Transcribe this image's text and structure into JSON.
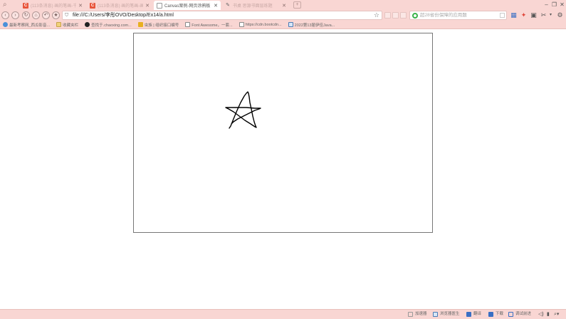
{
  "browser": {
    "tabs": [
      {
        "title": "(113条消息) 画的笔画-千...",
        "favicon": "c-logo-icon",
        "active": false
      },
      {
        "title": "(113条消息) 画的笔画-画...",
        "favicon": "c-logo-icon",
        "active": false
      },
      {
        "title": "Canvas案例-网页涂鸦板",
        "favicon": "page-icon",
        "active": true
      },
      {
        "title": "书桌 思源书面层练题",
        "favicon": "quill-icon",
        "active": false
      }
    ],
    "new_tab_label": "+",
    "address_bar": {
      "url": "file:///C:/Users/李彤OVO/Desktop/Ex14/a.html"
    },
    "search_bar": {
      "placeholder": "超28省份保障的应用题"
    },
    "bookmarks": [
      {
        "label": "最新考察网_西瓜影音...",
        "icon": "blue-circle-icon"
      },
      {
        "label": "收藏夹栏",
        "icon": "folder-icon"
      },
      {
        "label": "查找于.chaoxing.com...",
        "icon": "chaoxing-icon"
      },
      {
        "label": "虫族 | 组织接口编号",
        "icon": "avatar-icon"
      },
      {
        "label": "Font Awesome，一套...",
        "icon": "page-icon"
      },
      {
        "label": "https://cdn.bootcdn...",
        "icon": "page-icon"
      },
      {
        "label": "2022第13届伊佳Java...",
        "icon": "calendar-icon"
      }
    ]
  },
  "status_bar": {
    "items": [
      "加速器",
      "浏览器医生",
      "翻译",
      "下载",
      "调试前进"
    ]
  },
  "canvas": {
    "drawing": "hand-drawn five-pointed star",
    "stroke_color": "#000000"
  }
}
